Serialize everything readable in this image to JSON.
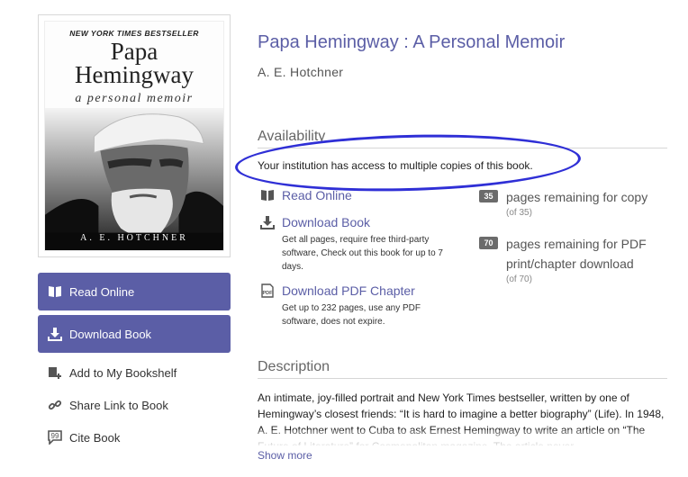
{
  "cover": {
    "banner": "NEW YORK TIMES BESTSELLER",
    "title_line1": "Papa",
    "title_line2": "Hemingway",
    "subtitle": "a personal memoir",
    "author": "A. E. HOTCHNER"
  },
  "actions": {
    "read_online": "Read Online",
    "download_book": "Download Book",
    "add_bookshelf": "Add to My Bookshelf",
    "share_link": "Share Link to Book",
    "cite": "Cite Book"
  },
  "book": {
    "title": "Papa Hemingway : A Personal Memoir",
    "author": "A. E. Hotchner"
  },
  "availability": {
    "heading": "Availability",
    "access_text": "Your institution has access to multiple copies of this book.",
    "options": [
      {
        "label": "Read Online",
        "icon": "book-icon",
        "desc": ""
      },
      {
        "label": "Download Book",
        "icon": "download-icon",
        "desc": "Get all pages, require free third-party software, Check out this book for up to 7 days."
      },
      {
        "label": "Download PDF Chapter",
        "icon": "pdf-icon",
        "desc": "Get up to 232 pages, use any PDF software, does not expire."
      }
    ],
    "quotas": [
      {
        "count": "35",
        "label": "pages remaining for copy",
        "of": "(of 35)"
      },
      {
        "count": "70",
        "label": "pages remaining for PDF print/chapter download",
        "of": "(of 70)"
      }
    ]
  },
  "description": {
    "heading": "Description",
    "text": "An intimate, joy-filled portrait and New York Times bestseller, written by one of Hemingway’s closest friends: “It is hard to imagine a better biography” (Life). In 1948, A. E. Hotchner went to Cuba to ask Ernest Hemingway to write an article on “The Future of Literature” for Cosmopolitan magazine. The article never",
    "show_more": "Show more"
  },
  "colors": {
    "accent": "#5b5ea6",
    "annotation": "#2f2fd6",
    "badge": "#6b6b6b"
  }
}
